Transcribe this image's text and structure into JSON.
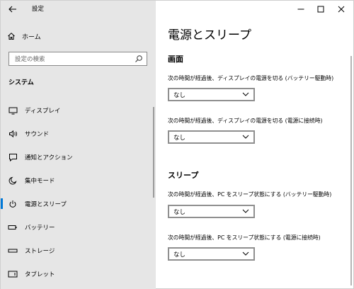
{
  "window": {
    "title": "設定",
    "controls": {
      "minimize": "—",
      "maximize": "☐",
      "close": "✕"
    }
  },
  "sidebar": {
    "home_label": "ホーム",
    "search_placeholder": "設定の検索",
    "section_label": "システム",
    "items": [
      {
        "label": "ディスプレイ",
        "icon": "display-icon"
      },
      {
        "label": "サウンド",
        "icon": "speaker-icon"
      },
      {
        "label": "通知とアクション",
        "icon": "notification-icon"
      },
      {
        "label": "集中モード",
        "icon": "moon-icon"
      },
      {
        "label": "電源とスリープ",
        "icon": "power-icon",
        "selected": true
      },
      {
        "label": "バッテリー",
        "icon": "battery-icon"
      },
      {
        "label": "ストレージ",
        "icon": "storage-icon"
      },
      {
        "label": "タブレット",
        "icon": "tablet-icon"
      }
    ]
  },
  "main": {
    "title": "電源とスリープ",
    "screen": {
      "heading": "画面",
      "battery_label": "次の時間が経過後、ディスプレイの電源を切る (バッテリー駆動時)",
      "battery_value": "なし",
      "plugged_label": "次の時間が経過後、ディスプレイの電源を切る (電源に接続時)",
      "plugged_value": "なし"
    },
    "sleep": {
      "heading": "スリープ",
      "battery_label": "次の時間が経過後、PC をスリープ状態にする (バッテリー駆動時)",
      "battery_value": "なし",
      "plugged_label": "次の時間が経過後、PC をスリープ状態にする (電源に接続時)",
      "plugged_value": "なし"
    }
  },
  "colors": {
    "accent": "#0078d7",
    "sidebar_bg": "#e6e6e6"
  }
}
